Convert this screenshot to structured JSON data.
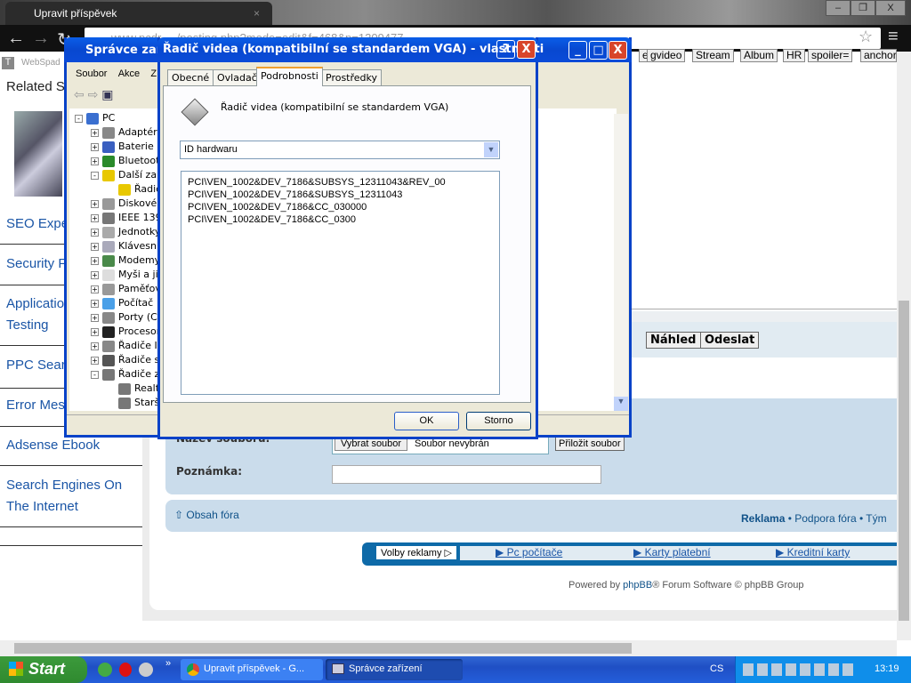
{
  "browser": {
    "tab_title": "Upravit příspěvek",
    "address": "www.pcdr...../posting.php?mode=edit&f=468&p=1209477"
  },
  "page": {
    "logo_text": "WebSpad",
    "sidebar": {
      "heading": "Related S",
      "links": [
        "SEO Expe",
        "Security F",
        "Application",
        "Testing",
        "PPC Sear",
        "Error Mes",
        "Adsense Ebook",
        "Search Engines On",
        "The Internet"
      ]
    },
    "editor_buttons": [
      "e",
      "gvideo",
      "Stream",
      "Album",
      "HR",
      "spoiler=",
      "anchor"
    ],
    "preview_button": "Náhled",
    "submit_button": "Odeslat",
    "file_label": "Název souboru:",
    "choose_file": "Vybrat soubor",
    "no_file": "Soubor nevybrán",
    "attach_button": "Přiložit soubor",
    "note_label": "Poznámka:",
    "forum_index": "Obsah fóra",
    "footer_links": {
      "ads": "Reklama",
      "support": "Podpora fóra",
      "team": "Tým"
    },
    "ad_bar": {
      "label": "Volby reklamy",
      "links": [
        "Pc počítače",
        "Karty platební",
        "Kreditní karty"
      ]
    },
    "powered_by": [
      "Powered by ",
      "phpBB",
      "® Forum Software © phpBB Group"
    ]
  },
  "devmgr": {
    "title": "Správce zařízení",
    "menu": [
      "Soubor",
      "Akce",
      "Z"
    ],
    "tree": [
      {
        "label": "PC",
        "level": 0,
        "exp": "-",
        "color": "#3a6fd0"
      },
      {
        "label": "Adaptéry",
        "level": 1,
        "exp": "+",
        "color": "#888"
      },
      {
        "label": "Baterie",
        "level": 1,
        "exp": "+",
        "color": "#3a5fc0"
      },
      {
        "label": "Bluetooth",
        "level": 1,
        "exp": "+",
        "color": "#2a8a2a"
      },
      {
        "label": "Další zař",
        "level": 1,
        "exp": "-",
        "color": "#e8c800"
      },
      {
        "label": "Řadič",
        "level": 2,
        "exp": "",
        "color": "#e8c800"
      },
      {
        "label": "Diskové",
        "level": 1,
        "exp": "+",
        "color": "#999"
      },
      {
        "label": "IEEE 139",
        "level": 1,
        "exp": "+",
        "color": "#777"
      },
      {
        "label": "Jednotky",
        "level": 1,
        "exp": "+",
        "color": "#aaa"
      },
      {
        "label": "Klávesnic",
        "level": 1,
        "exp": "+",
        "color": "#aab"
      },
      {
        "label": "Modemy",
        "level": 1,
        "exp": "+",
        "color": "#4a8a4a"
      },
      {
        "label": "Myši a jin",
        "level": 1,
        "exp": "+",
        "color": "#ddd"
      },
      {
        "label": "Paměťov",
        "level": 1,
        "exp": "+",
        "color": "#999"
      },
      {
        "label": "Počítač",
        "level": 1,
        "exp": "+",
        "color": "#4aa0e8"
      },
      {
        "label": "Porty (C",
        "level": 1,
        "exp": "+",
        "color": "#888"
      },
      {
        "label": "Procesor",
        "level": 1,
        "exp": "+",
        "color": "#222"
      },
      {
        "label": "Řadiče IE",
        "level": 1,
        "exp": "+",
        "color": "#888"
      },
      {
        "label": "Řadiče s",
        "level": 1,
        "exp": "+",
        "color": "#555"
      },
      {
        "label": "Řadiče z",
        "level": 1,
        "exp": "-",
        "color": "#777"
      },
      {
        "label": "Realtek",
        "level": 2,
        "exp": "",
        "color": "#777"
      },
      {
        "label": "Starší",
        "level": 2,
        "exp": "",
        "color": "#777"
      }
    ]
  },
  "dialog": {
    "title": "Řadič videa (kompatibilní se standardem VGA) - vlastnosti",
    "tabs": [
      "Obecné",
      "Ovladač",
      "Podrobnosti",
      "Prostředky"
    ],
    "active_tab": "Podrobnosti",
    "device_name": "Řadič videa (kompatibilní se standardem VGA)",
    "property": "ID hardwaru",
    "values": [
      "PCI\\VEN_1002&DEV_7186&SUBSYS_12311043&REV_00",
      "PCI\\VEN_1002&DEV_7186&SUBSYS_12311043",
      "PCI\\VEN_1002&DEV_7186&CC_030000",
      "PCI\\VEN_1002&DEV_7186&CC_0300"
    ],
    "ok": "OK",
    "cancel": "Storno"
  },
  "taskbar": {
    "start": "Start",
    "tasks": [
      "Upravit příspěvek - G...",
      "Správce zařízení"
    ],
    "lang": "CS",
    "clock": "13:19"
  }
}
